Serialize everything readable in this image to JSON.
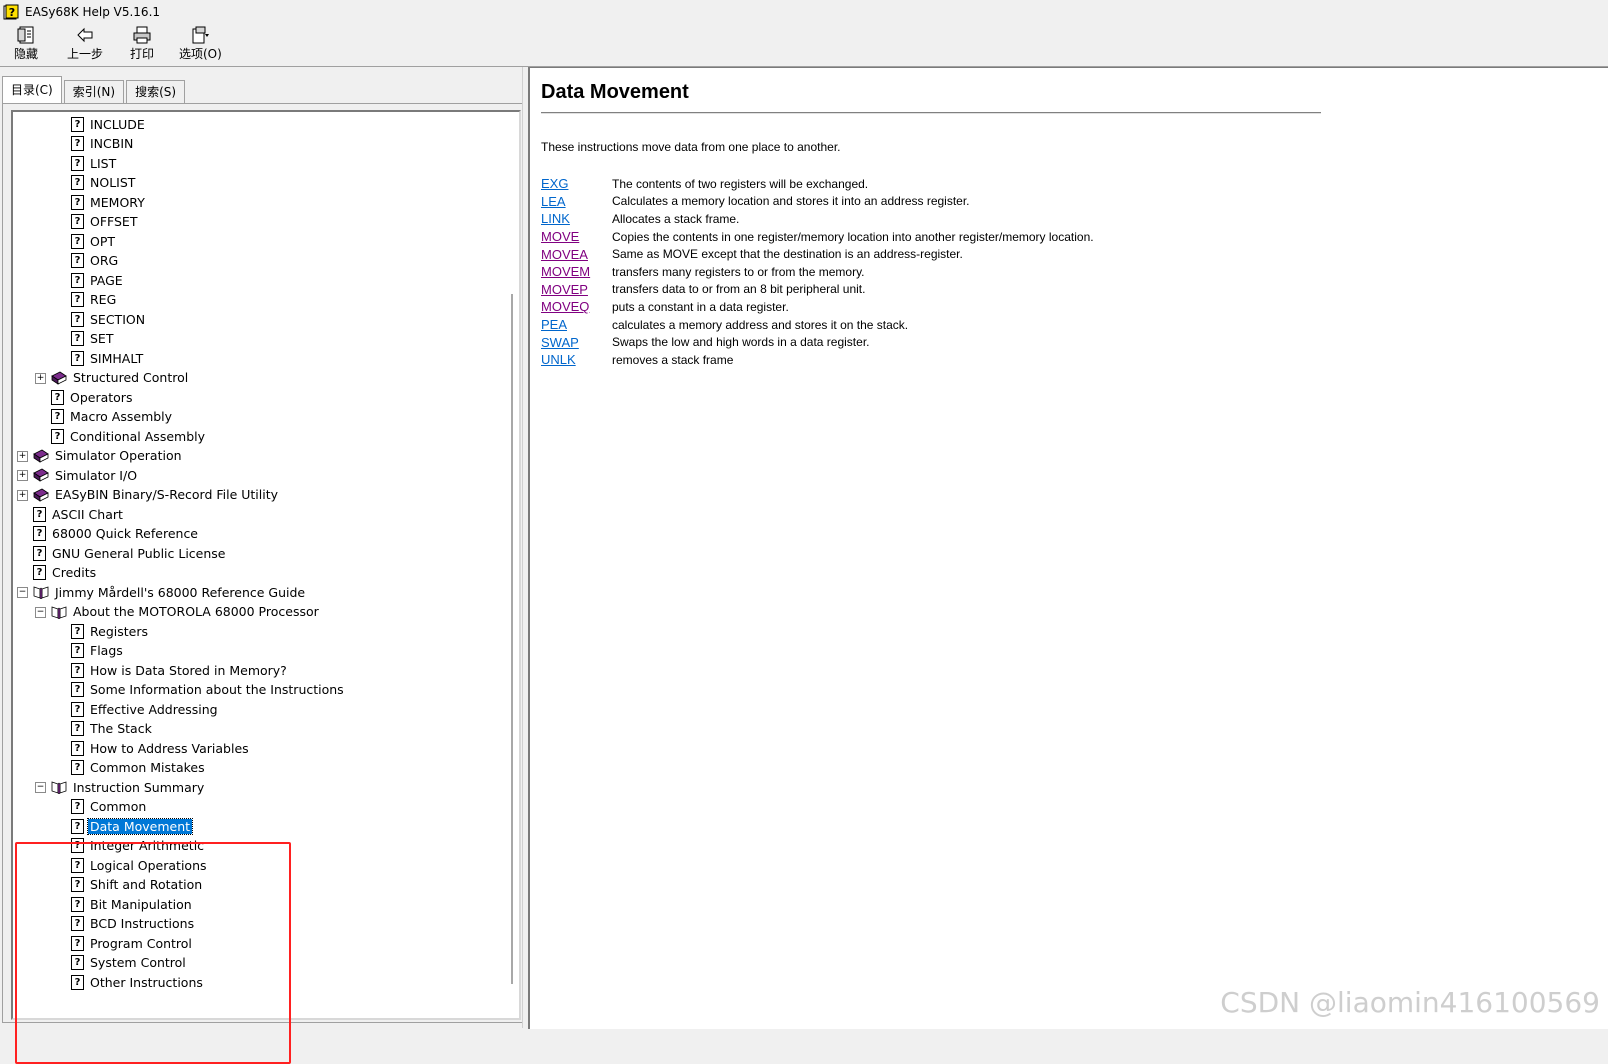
{
  "window": {
    "title": "EASy68K Help V5.16.1"
  },
  "toolbar": {
    "buttons": [
      {
        "label": "隐藏",
        "icon": "hide-icon"
      },
      {
        "label": "上一步",
        "icon": "back-arrow-icon"
      },
      {
        "label": "打印",
        "icon": "printer-icon"
      },
      {
        "label": "选项(O)",
        "icon": "options-icon"
      }
    ]
  },
  "tabs": [
    {
      "label": "目录(C)",
      "active": true
    },
    {
      "label": "索引(N)",
      "active": false
    },
    {
      "label": "搜索(S)",
      "active": false
    }
  ],
  "tree": {
    "items": [
      {
        "label": "INCLUDE",
        "level": 3,
        "icon": "page",
        "expander": null
      },
      {
        "label": "INCBIN",
        "level": 3,
        "icon": "page",
        "expander": null
      },
      {
        "label": "LIST",
        "level": 3,
        "icon": "page",
        "expander": null
      },
      {
        "label": "NOLIST",
        "level": 3,
        "icon": "page",
        "expander": null
      },
      {
        "label": "MEMORY",
        "level": 3,
        "icon": "page",
        "expander": null
      },
      {
        "label": "OFFSET",
        "level": 3,
        "icon": "page",
        "expander": null
      },
      {
        "label": "OPT",
        "level": 3,
        "icon": "page",
        "expander": null
      },
      {
        "label": "ORG",
        "level": 3,
        "icon": "page",
        "expander": null
      },
      {
        "label": "PAGE",
        "level": 3,
        "icon": "page",
        "expander": null
      },
      {
        "label": "REG",
        "level": 3,
        "icon": "page",
        "expander": null
      },
      {
        "label": "SECTION",
        "level": 3,
        "icon": "page",
        "expander": null
      },
      {
        "label": "SET",
        "level": 3,
        "icon": "page",
        "expander": null
      },
      {
        "label": "SIMHALT",
        "level": 3,
        "icon": "page",
        "expander": null
      },
      {
        "label": "Structured Control",
        "level": 2,
        "icon": "book-closed",
        "expander": "+"
      },
      {
        "label": "Operators",
        "level": 2,
        "icon": "page",
        "expander": null
      },
      {
        "label": "Macro Assembly",
        "level": 2,
        "icon": "page",
        "expander": null
      },
      {
        "label": "Conditional Assembly",
        "level": 2,
        "icon": "page",
        "expander": null
      },
      {
        "label": "Simulator Operation",
        "level": 1,
        "icon": "book-closed",
        "expander": "+"
      },
      {
        "label": "Simulator I/O",
        "level": 1,
        "icon": "book-closed",
        "expander": "+"
      },
      {
        "label": "EASyBIN Binary/S-Record File Utility",
        "level": 1,
        "icon": "book-closed",
        "expander": "+"
      },
      {
        "label": "ASCII Chart",
        "level": 1,
        "icon": "page",
        "expander": null
      },
      {
        "label": "68000 Quick Reference",
        "level": 1,
        "icon": "page",
        "expander": null
      },
      {
        "label": "GNU General Public License",
        "level": 1,
        "icon": "page",
        "expander": null
      },
      {
        "label": "Credits",
        "level": 1,
        "icon": "page",
        "expander": null
      },
      {
        "label": "Jimmy Mårdell's 68000 Reference Guide",
        "level": 1,
        "icon": "book-open",
        "expander": "-"
      },
      {
        "label": "About the MOTOROLA 68000 Processor",
        "level": 2,
        "icon": "book-open",
        "expander": "-"
      },
      {
        "label": "Registers",
        "level": 3,
        "icon": "page",
        "expander": null
      },
      {
        "label": "Flags",
        "level": 3,
        "icon": "page",
        "expander": null
      },
      {
        "label": "How is Data Stored in Memory?",
        "level": 3,
        "icon": "page",
        "expander": null
      },
      {
        "label": "Some Information about the Instructions",
        "level": 3,
        "icon": "page",
        "expander": null
      },
      {
        "label": "Effective Addressing",
        "level": 3,
        "icon": "page",
        "expander": null
      },
      {
        "label": "The Stack",
        "level": 3,
        "icon": "page",
        "expander": null
      },
      {
        "label": "How to Address Variables",
        "level": 3,
        "icon": "page",
        "expander": null
      },
      {
        "label": "Common Mistakes",
        "level": 3,
        "icon": "page",
        "expander": null
      },
      {
        "label": "Instruction Summary",
        "level": 2,
        "icon": "book-open",
        "expander": "-"
      },
      {
        "label": "Common",
        "level": 3,
        "icon": "page",
        "expander": null
      },
      {
        "label": "Data Movement",
        "level": 3,
        "icon": "page",
        "expander": null,
        "selected": true
      },
      {
        "label": "Integer Arithmetic",
        "level": 3,
        "icon": "page",
        "expander": null
      },
      {
        "label": "Logical Operations",
        "level": 3,
        "icon": "page",
        "expander": null
      },
      {
        "label": "Shift and Rotation",
        "level": 3,
        "icon": "page",
        "expander": null
      },
      {
        "label": "Bit Manipulation",
        "level": 3,
        "icon": "page",
        "expander": null
      },
      {
        "label": "BCD Instructions",
        "level": 3,
        "icon": "page",
        "expander": null
      },
      {
        "label": "Program Control",
        "level": 3,
        "icon": "page",
        "expander": null
      },
      {
        "label": "System Control",
        "level": 3,
        "icon": "page",
        "expander": null
      },
      {
        "label": "Other Instructions",
        "level": 3,
        "icon": "page",
        "expander": null
      }
    ]
  },
  "content": {
    "title": "Data Movement",
    "intro": "These instructions move data from one place to another.",
    "instructions": [
      {
        "name": "EXG",
        "visited": false,
        "desc": "The contents of two registers will be exchanged."
      },
      {
        "name": "LEA",
        "visited": false,
        "desc": "Calculates a memory location and stores it into an address register."
      },
      {
        "name": "LINK",
        "visited": false,
        "desc": "Allocates a stack frame."
      },
      {
        "name": "MOVE",
        "visited": true,
        "desc": "Copies the contents in one register/memory location into another register/memory location."
      },
      {
        "name": "MOVEA",
        "visited": true,
        "desc": "Same as MOVE except that the destination is an address-register."
      },
      {
        "name": "MOVEM",
        "visited": true,
        "desc": "transfers many registers to or from the memory."
      },
      {
        "name": "MOVEP",
        "visited": true,
        "desc": "transfers data to or from an 8 bit peripheral unit."
      },
      {
        "name": "MOVEQ",
        "visited": true,
        "desc": "puts a constant in a data register."
      },
      {
        "name": "PEA",
        "visited": false,
        "desc": "calculates a memory address and stores it on the stack."
      },
      {
        "name": "SWAP",
        "visited": false,
        "desc": "Swaps the low and high words in a data register."
      },
      {
        "name": "UNLK",
        "visited": false,
        "desc": "removes a stack frame"
      }
    ]
  },
  "watermark": "CSDN @liaomin416100569",
  "colors": {
    "selection": "#0078d7",
    "link": "#0066cc",
    "visited_link": "#800080",
    "highlight_box": "#ff2020",
    "book": "#7b2c8c"
  }
}
